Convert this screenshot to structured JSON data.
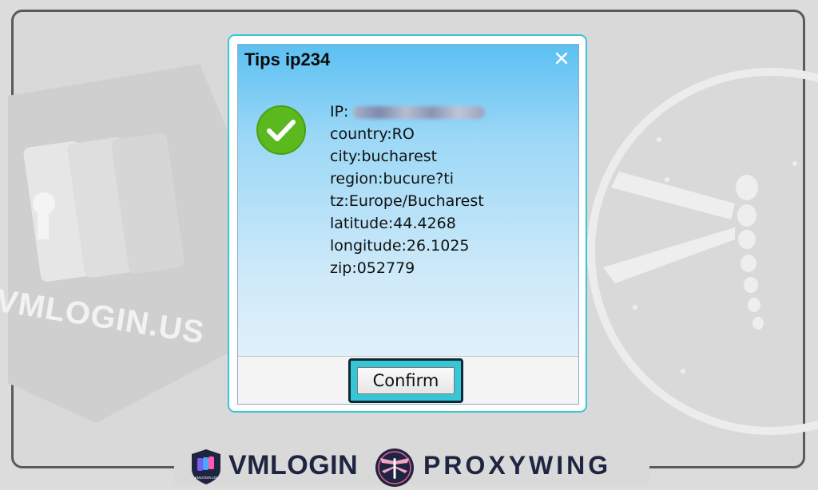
{
  "background": {
    "watermark_text": "VMLOGIN.US"
  },
  "dialog": {
    "title": "Tips ip234",
    "close_icon": "close-icon",
    "status_icon": "check-circle-icon",
    "accent_color": "#36c6d6",
    "lines": {
      "ip_label": "IP:",
      "country": "country:RO",
      "city": "city:bucharest",
      "region": "region:bucure?ti",
      "tz": "tz:Europe/Bucharest",
      "latitude": "latitude:44.4268",
      "longitude": "longitude:26.1025",
      "zip": "zip:052779"
    },
    "confirm_label": "Confirm"
  },
  "branding": {
    "vmlogin": "VMLOGIN",
    "vmlogin_badge_text": "VMLOGIN.US",
    "proxywing": "PROXYWING"
  }
}
